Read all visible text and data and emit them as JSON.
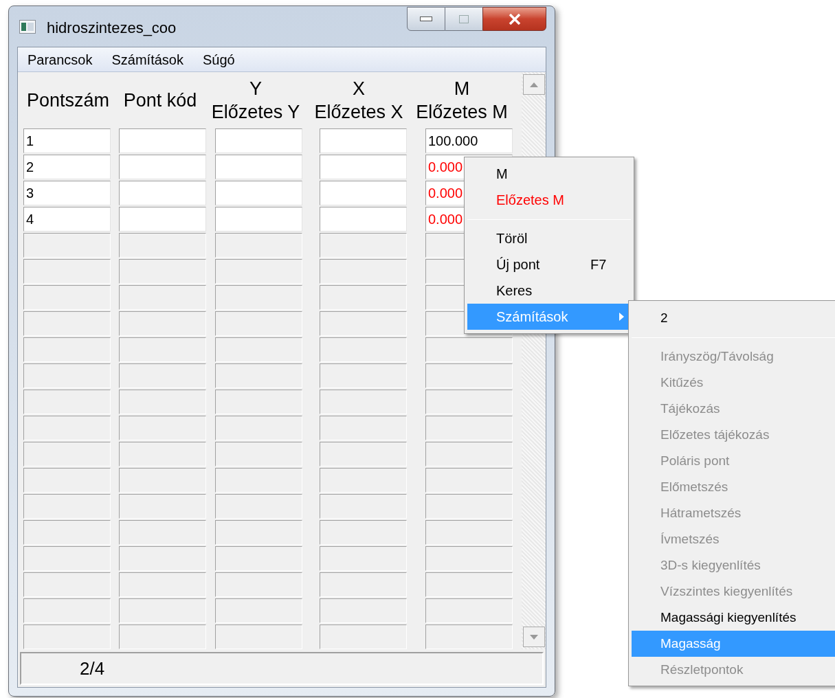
{
  "window": {
    "title": "hidroszintezes_coo"
  },
  "menu_bar": [
    {
      "label": "Parancsok"
    },
    {
      "label": "Számítások"
    },
    {
      "label": "Súgó"
    }
  ],
  "table": {
    "columns": [
      {
        "label": "Pontszám"
      },
      {
        "label": "Pont kód"
      },
      {
        "label": "Y",
        "sublabel": "Előzetes Y"
      },
      {
        "label": "X",
        "sublabel": "Előzetes X"
      },
      {
        "label": "M",
        "sublabel": "Előzetes M"
      }
    ],
    "rows": [
      {
        "kind": "filled",
        "number": "1",
        "m": "100.000",
        "m_flagged": false
      },
      {
        "kind": "filled",
        "number": "2",
        "m": "0.000",
        "m_flagged": true
      },
      {
        "kind": "filled",
        "number": "3",
        "m": "0.000",
        "m_flagged": true
      },
      {
        "kind": "filled",
        "number": "4",
        "m": "0.000",
        "m_flagged": true
      },
      {
        "kind": "empty"
      },
      {
        "kind": "empty"
      },
      {
        "kind": "empty"
      },
      {
        "kind": "empty"
      },
      {
        "kind": "empty"
      },
      {
        "kind": "empty"
      },
      {
        "kind": "empty"
      },
      {
        "kind": "empty"
      },
      {
        "kind": "empty"
      },
      {
        "kind": "empty"
      },
      {
        "kind": "empty"
      },
      {
        "kind": "empty"
      },
      {
        "kind": "empty"
      },
      {
        "kind": "empty"
      },
      {
        "kind": "empty"
      },
      {
        "kind": "empty"
      }
    ]
  },
  "status_bar": {
    "text": "2/4"
  },
  "context_menu": [
    {
      "kind": "item",
      "label": "M",
      "flagged": false,
      "selected": false
    },
    {
      "kind": "item",
      "label": "Előzetes M",
      "flagged": true,
      "selected": false
    },
    {
      "kind": "separator"
    },
    {
      "kind": "item",
      "label": "Töröl",
      "flagged": false,
      "selected": false
    },
    {
      "kind": "item",
      "label": "Új pont",
      "shortcut": "F7",
      "flagged": false,
      "selected": false
    },
    {
      "kind": "item",
      "label": "Keres",
      "flagged": false,
      "selected": false
    },
    {
      "kind": "submenu",
      "label": "Számítások",
      "flagged": false,
      "selected": true
    }
  ],
  "submenu": [
    {
      "kind": "item",
      "label": "2",
      "disabled": false,
      "selected": false
    },
    {
      "kind": "separator"
    },
    {
      "kind": "item",
      "label": "Irányszög/Távolság",
      "disabled": true,
      "selected": false
    },
    {
      "kind": "item",
      "label": "Kitűzés",
      "disabled": true,
      "selected": false
    },
    {
      "kind": "item",
      "label": "Tájékozás",
      "disabled": true,
      "selected": false
    },
    {
      "kind": "item",
      "label": "Előzetes tájékozás",
      "disabled": true,
      "selected": false
    },
    {
      "kind": "item",
      "label": "Poláris pont",
      "disabled": true,
      "selected": false
    },
    {
      "kind": "item",
      "label": "Előmetszés",
      "disabled": true,
      "selected": false
    },
    {
      "kind": "item",
      "label": "Hátrametszés",
      "disabled": true,
      "selected": false
    },
    {
      "kind": "item",
      "label": "Ívmetszés",
      "disabled": true,
      "selected": false
    },
    {
      "kind": "item",
      "label": "3D-s kiegyenlítés",
      "disabled": true,
      "selected": false
    },
    {
      "kind": "item",
      "label": "Vízszintes kiegyenlítés",
      "disabled": true,
      "selected": false
    },
    {
      "kind": "item",
      "label": "Magassági kiegyenlítés",
      "disabled": false,
      "selected": false
    },
    {
      "kind": "item",
      "label": "Magasság",
      "disabled": false,
      "selected": true
    },
    {
      "kind": "item",
      "label": "Részletpontok",
      "disabled": true,
      "selected": false
    }
  ]
}
